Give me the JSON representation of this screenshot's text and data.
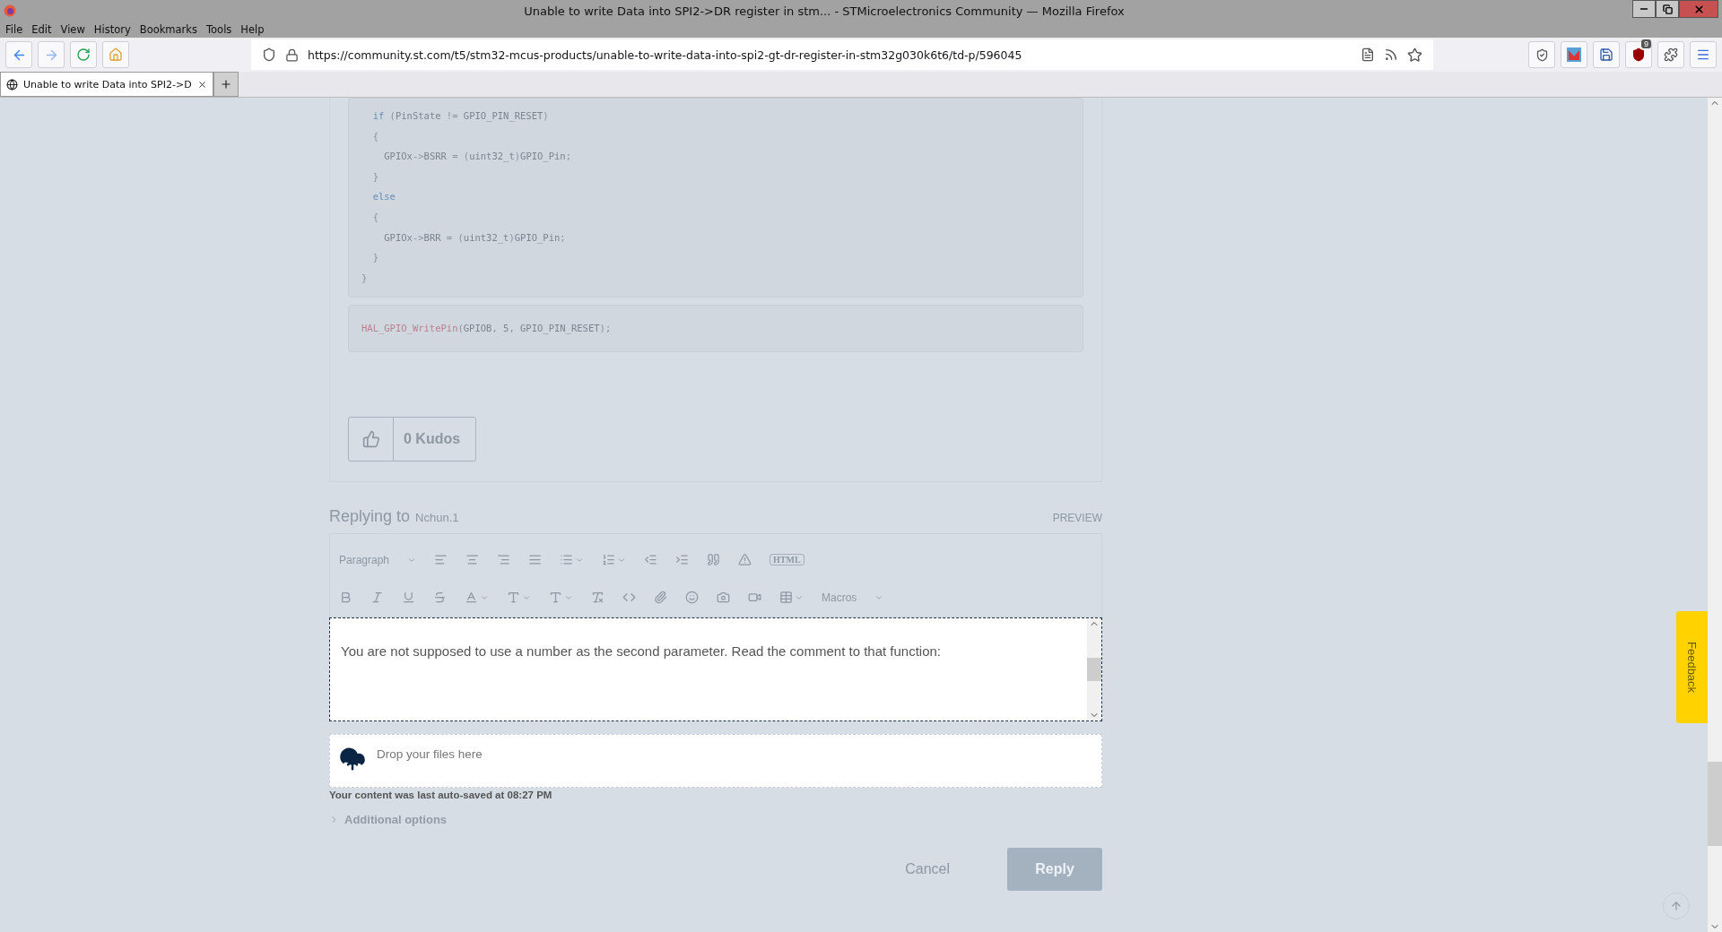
{
  "window": {
    "title": "Unable to write Data into SPI2->DR register in stm... - STMicroelectronics Community — Mozilla Firefox"
  },
  "menu": [
    "File",
    "Edit",
    "View",
    "History",
    "Bookmarks",
    "Tools",
    "Help"
  ],
  "address_bar": {
    "url": "https://community.st.com/t5/stm32-mcus-products/unable-to-write-data-into-spi2-gt-dr-register-in-stm32g030k6t6/td-p/596045"
  },
  "extension_badge": "9",
  "tabs": [
    {
      "label": "Unable to write Data into SPI2->D",
      "selected": true
    }
  ],
  "code_blocks": [
    {
      "lines": [
        [
          {
            "kind": "keyword",
            "text": "  if"
          },
          {
            "kind": "punct",
            "text": " ("
          },
          {
            "kind": "plain",
            "text": "PinState"
          },
          {
            "kind": "punct",
            "text": " != "
          },
          {
            "kind": "plain",
            "text": "GPIO_PIN_RESET"
          },
          {
            "kind": "punct",
            "text": ")"
          }
        ],
        [
          {
            "kind": "punct",
            "text": "  {"
          }
        ],
        [
          {
            "kind": "plain",
            "text": "    GPIOx"
          },
          {
            "kind": "punct",
            "text": "->"
          },
          {
            "kind": "plain",
            "text": "BSRR"
          },
          {
            "kind": "punct",
            "text": " = ("
          },
          {
            "kind": "plain",
            "text": "uint32_t"
          },
          {
            "kind": "punct",
            "text": ")"
          },
          {
            "kind": "plain",
            "text": "GPIO_Pin"
          },
          {
            "kind": "punct",
            "text": ";"
          }
        ],
        [
          {
            "kind": "punct",
            "text": "  }"
          }
        ],
        [
          {
            "kind": "keyword",
            "text": "  else"
          }
        ],
        [
          {
            "kind": "punct",
            "text": "  {"
          }
        ],
        [
          {
            "kind": "plain",
            "text": "    GPIOx"
          },
          {
            "kind": "punct",
            "text": "->"
          },
          {
            "kind": "plain",
            "text": "BRR"
          },
          {
            "kind": "punct",
            "text": " = ("
          },
          {
            "kind": "plain",
            "text": "uint32_t"
          },
          {
            "kind": "punct",
            "text": ")"
          },
          {
            "kind": "plain",
            "text": "GPIO_Pin"
          },
          {
            "kind": "punct",
            "text": ";"
          }
        ],
        [
          {
            "kind": "punct",
            "text": "  }"
          }
        ],
        [
          {
            "kind": "punct",
            "text": "}"
          }
        ]
      ]
    },
    {
      "lines": [
        [
          {
            "kind": "function",
            "text": "HAL_GPIO_WritePin"
          },
          {
            "kind": "punct",
            "text": "("
          },
          {
            "kind": "plain",
            "text": "GPIOB"
          },
          {
            "kind": "punct",
            "text": ", "
          },
          {
            "kind": "plain",
            "text": "5"
          },
          {
            "kind": "punct",
            "text": ", "
          },
          {
            "kind": "plain",
            "text": "GPIO_PIN_RESET"
          },
          {
            "kind": "punct",
            "text": ");"
          }
        ]
      ]
    }
  ],
  "kudos": {
    "label": "0 Kudos"
  },
  "reply": {
    "heading": "Replying to",
    "user": "Nchun.1",
    "preview": "PREVIEW",
    "toolbar": {
      "paragraph": "Paragraph",
      "html": "HTML",
      "macros": "Macros"
    },
    "body": "You are not supposed to use a number as the second parameter. Read the comment to that function:",
    "dropzone": "Drop your files here",
    "autosave": "Your content was last auto-saved at 08:27 PM",
    "additional_options": {
      "label": "Additional options",
      "expanded": false
    },
    "buttons": {
      "cancel": "Cancel",
      "reply": "Reply"
    }
  },
  "feedback": "Feedback"
}
